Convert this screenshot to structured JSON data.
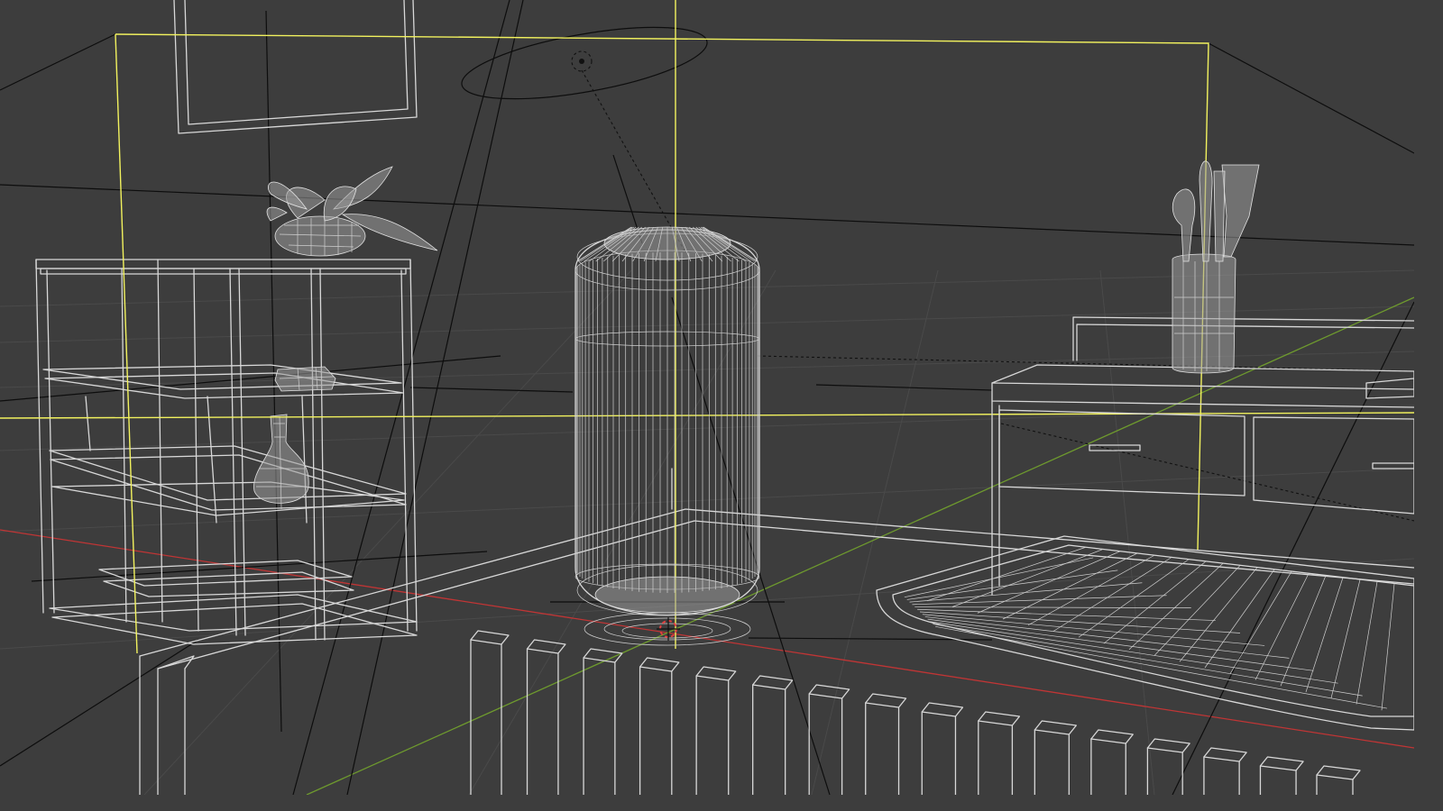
{
  "viewport": {
    "mode": "wireframe",
    "background_color": "#3d3d3d",
    "wire_color": "#d8d8d8",
    "active_selection_color": "#f2f25e",
    "x_axis_color": "#c03535",
    "y_axis_color": "#6e9a2e",
    "relationship_line_color": "#0d0d0d"
  },
  "objects": [
    {
      "name": "picture-frame",
      "type": "mesh"
    },
    {
      "name": "area-light",
      "type": "light"
    },
    {
      "name": "camera-frame",
      "type": "camera",
      "selected": true
    },
    {
      "name": "shelving-unit",
      "type": "mesh"
    },
    {
      "name": "potted-plant",
      "type": "mesh"
    },
    {
      "name": "vase",
      "type": "mesh"
    },
    {
      "name": "small-box",
      "type": "mesh"
    },
    {
      "name": "cylinder-lamp",
      "type": "mesh"
    },
    {
      "name": "kitchen-counter",
      "type": "mesh"
    },
    {
      "name": "utensil-holder",
      "type": "mesh"
    },
    {
      "name": "tray",
      "type": "mesh"
    },
    {
      "name": "fence-posts",
      "type": "mesh"
    },
    {
      "name": "table-platform",
      "type": "mesh"
    },
    {
      "name": "3d-cursor",
      "type": "cursor"
    }
  ]
}
